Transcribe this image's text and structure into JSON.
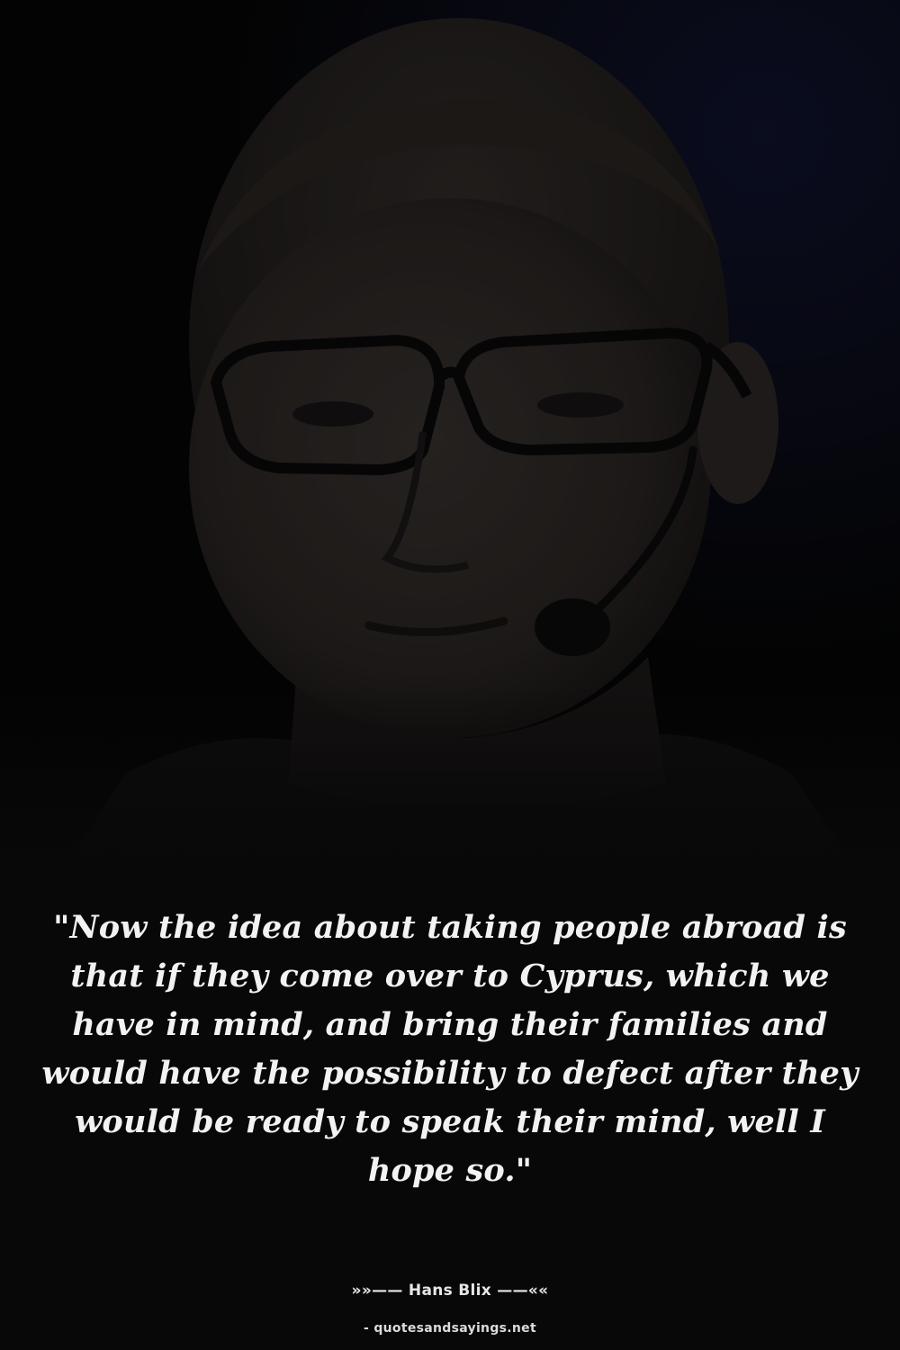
{
  "quote": {
    "text": "\"Now the idea about taking people abroad is that if they come over to Cyprus, which we have in mind, and bring their families and would have the possibility to defect after they would be ready to speak their mind, well I hope so.\""
  },
  "attribution": {
    "author": "»»—— Hans Blix ——««",
    "source": "- quotesandsayings.net"
  },
  "colors": {
    "background": "#080808",
    "text": "#f2f2f2"
  }
}
